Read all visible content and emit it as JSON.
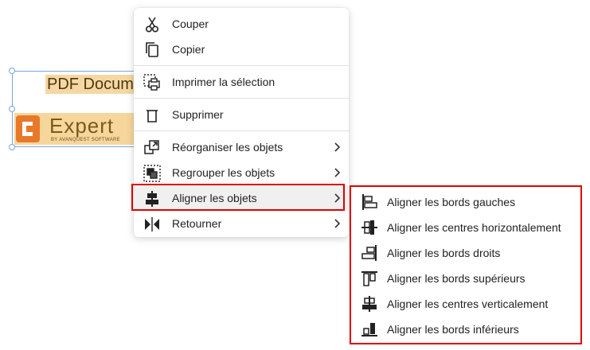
{
  "document": {
    "title_text": "PDF Docum",
    "logo_text": "Expert",
    "logo_sub": "BY AVANQUEST SOFTWARE"
  },
  "menu": {
    "items": [
      {
        "label": "Couper",
        "icon": "scissors-icon"
      },
      {
        "label": "Copier",
        "icon": "copy-icon"
      },
      {
        "label": "Imprimer la sélection",
        "icon": "print-selection-icon"
      },
      {
        "label": "Supprimer",
        "icon": "trash-icon"
      },
      {
        "label": "Réorganiser les objets",
        "icon": "arrange-icon",
        "submenu": true
      },
      {
        "label": "Regrouper les objets",
        "icon": "group-icon",
        "submenu": true
      },
      {
        "label": "Aligner les objets",
        "icon": "align-icon",
        "submenu": true,
        "active": true
      },
      {
        "label": "Retourner",
        "icon": "flip-icon",
        "submenu": true
      }
    ]
  },
  "submenu": {
    "items": [
      {
        "label": "Aligner les bords gauches",
        "icon": "align-left-icon"
      },
      {
        "label": "Aligner les centres horizontalement",
        "icon": "align-center-horizontal-icon"
      },
      {
        "label": "Aligner les bords droits",
        "icon": "align-right-icon"
      },
      {
        "label": "Aligner les bords supérieurs",
        "icon": "align-top-icon"
      },
      {
        "label": "Aligner les centres verticalement",
        "icon": "align-center-vertical-icon"
      },
      {
        "label": "Aligner les bords inférieurs",
        "icon": "align-bottom-icon"
      }
    ]
  },
  "colors": {
    "highlight_border": "#e00000",
    "selection_frame": "#7aa6e0",
    "logo_orange": "#e8792a"
  }
}
